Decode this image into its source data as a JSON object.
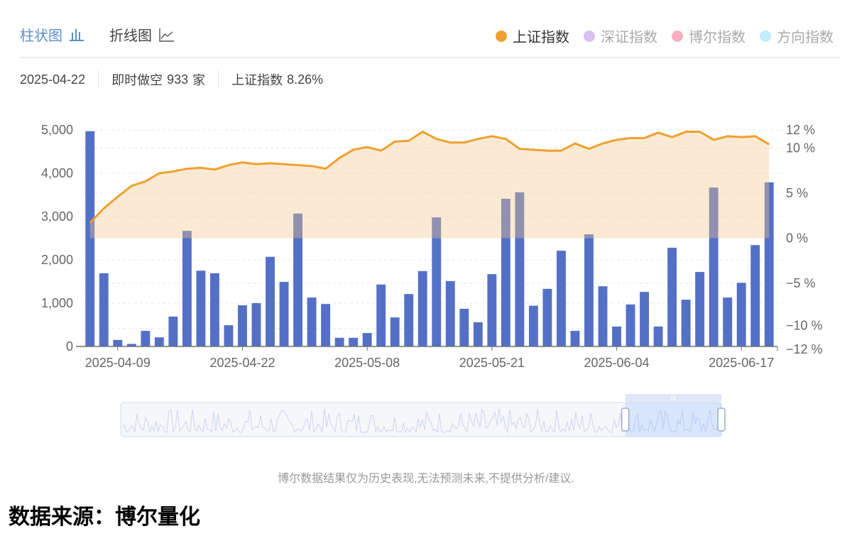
{
  "tabs": [
    {
      "label": "柱状图",
      "icon": "bar-chart-icon",
      "active": true
    },
    {
      "label": "折线图",
      "icon": "line-chart-icon",
      "active": false
    }
  ],
  "legend": [
    {
      "label": "上证指数",
      "color": "#f0a030",
      "active": true
    },
    {
      "label": "深证指数",
      "color": "#d9c0f2",
      "active": false
    },
    {
      "label": "博尔指数",
      "color": "#f6b0c0",
      "active": false
    },
    {
      "label": "方向指数",
      "color": "#c0eefb",
      "active": false
    }
  ],
  "info": {
    "date": "2025-04-22",
    "short_label": "即时做空",
    "short_value": "933",
    "short_unit": "家",
    "index_label": "上证指数",
    "index_value": "8.26%"
  },
  "chart_data": {
    "type": "bar",
    "series": [
      {
        "name": "即时做空",
        "type": "bar",
        "color": "#5470c6",
        "axis": "left",
        "values": [
          4970,
          1690,
          150,
          60,
          360,
          210,
          690,
          2670,
          1750,
          1690,
          490,
          950,
          1000,
          2070,
          1490,
          3070,
          1130,
          980,
          200,
          200,
          310,
          1430,
          670,
          1210,
          1740,
          2980,
          1510,
          870,
          560,
          1670,
          3410,
          3560,
          940,
          1330,
          2210,
          360,
          2590,
          1390,
          460,
          970,
          1260,
          460,
          2280,
          1080,
          1720,
          3670,
          1130,
          1470,
          2340,
          3790
        ]
      },
      {
        "name": "上证指数",
        "type": "line",
        "color": "#f0a030",
        "axis": "right",
        "area": true,
        "values": [
          1.7,
          3.3,
          4.6,
          5.8,
          6.3,
          7.2,
          7.4,
          7.7,
          7.8,
          7.6,
          8.1,
          8.4,
          8.2,
          8.3,
          8.2,
          8.1,
          8.0,
          7.7,
          8.9,
          9.8,
          10.1,
          9.7,
          10.7,
          10.8,
          11.8,
          11.0,
          10.6,
          10.6,
          11.0,
          11.3,
          11.0,
          9.9,
          9.8,
          9.7,
          9.7,
          10.5,
          9.9,
          10.5,
          10.9,
          11.1,
          11.1,
          11.7,
          11.2,
          11.8,
          11.8,
          10.9,
          11.3,
          11.2,
          11.3,
          10.4
        ]
      }
    ],
    "x_ticks": [
      {
        "index": 2,
        "label": "2025-04-09"
      },
      {
        "index": 11,
        "label": "2025-04-22"
      },
      {
        "index": 20,
        "label": "2025-05-08"
      },
      {
        "index": 29,
        "label": "2025-05-21"
      },
      {
        "index": 38,
        "label": "2025-06-04"
      },
      {
        "index": 47,
        "label": "2025-06-17"
      }
    ],
    "y_left": {
      "ylim": [
        0,
        5000
      ],
      "ticks": [
        0,
        1000,
        2000,
        3000,
        4000,
        5000
      ],
      "labels": [
        "0",
        "1,000",
        "2,000",
        "3,000",
        "4,000",
        "5,000"
      ]
    },
    "y_right": {
      "ylim": [
        -12,
        12
      ],
      "ticks": [
        -12,
        -10,
        -5,
        0,
        5,
        10,
        12
      ],
      "labels": [
        "-12 %",
        "-10 %",
        "-5 %",
        "0 %",
        "5 %",
        "10 %",
        "12 %"
      ]
    },
    "grid": true,
    "zoom_range_percent": [
      84,
      100
    ]
  },
  "disclaimer": "博尔数据结果仅为历史表现,无法预测未来,不提供分析/建议.",
  "source": "数据来源：博尔量化"
}
